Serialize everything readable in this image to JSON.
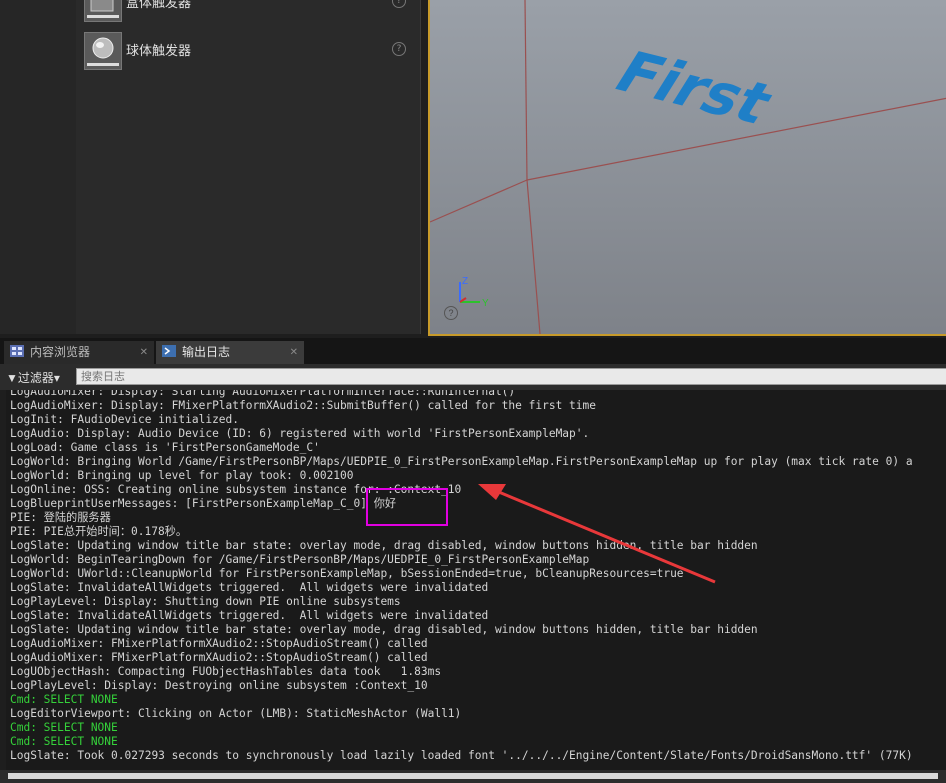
{
  "placement": {
    "items": [
      {
        "label": "盒体触发器"
      },
      {
        "label": "球体触发器"
      }
    ],
    "help_glyph": "?"
  },
  "viewport": {
    "floor_text": "First",
    "axes": {
      "z": "Z",
      "y": "Y"
    },
    "help_glyph": "?"
  },
  "tabs": [
    {
      "label": "内容浏览器",
      "active": false
    },
    {
      "label": "输出日志",
      "active": true
    }
  ],
  "tab_close_glyph": "✕",
  "filter": {
    "label": "▼过滤器▾",
    "search_placeholder": "搜索日志"
  },
  "log": [
    {
      "text": "LogAudioMixer: Display: Starting AudioMixerPlatformInterface::RunInternal()",
      "type": "normal"
    },
    {
      "text": "LogAudioMixer: Display: FMixerPlatformXAudio2::SubmitBuffer() called for the first time",
      "type": "normal"
    },
    {
      "text": "LogInit: FAudioDevice initialized.",
      "type": "normal"
    },
    {
      "text": "LogAudio: Display: Audio Device (ID: 6) registered with world 'FirstPersonExampleMap'.",
      "type": "normal"
    },
    {
      "text": "LogLoad: Game class is 'FirstPersonGameMode_C'",
      "type": "normal"
    },
    {
      "text": "LogWorld: Bringing World /Game/FirstPersonBP/Maps/UEDPIE_0_FirstPersonExampleMap.FirstPersonExampleMap up for play (max tick rate 0) a",
      "type": "normal"
    },
    {
      "text": "LogWorld: Bringing up level for play took: 0.002100",
      "type": "normal"
    },
    {
      "text": "LogOnline: OSS: Creating online subsystem instance for: :Context_10",
      "type": "normal"
    },
    {
      "text": "LogBlueprintUserMessages: [FirstPersonExampleMap_C_0] 你好",
      "type": "normal"
    },
    {
      "text": "PIE: 登陆的服务器",
      "type": "normal"
    },
    {
      "text": "PIE: PIE总开始时间：0.178秒。",
      "type": "normal"
    },
    {
      "text": "LogSlate: Updating window title bar state: overlay mode, drag disabled, window buttons hidden, title bar hidden",
      "type": "normal"
    },
    {
      "text": "LogWorld: BeginTearingDown for /Game/FirstPersonBP/Maps/UEDPIE_0_FirstPersonExampleMap",
      "type": "normal"
    },
    {
      "text": "LogWorld: UWorld::CleanupWorld for FirstPersonExampleMap, bSessionEnded=true, bCleanupResources=true",
      "type": "normal"
    },
    {
      "text": "LogSlate: InvalidateAllWidgets triggered.  All widgets were invalidated",
      "type": "normal"
    },
    {
      "text": "LogPlayLevel: Display: Shutting down PIE online subsystems",
      "type": "normal"
    },
    {
      "text": "LogSlate: InvalidateAllWidgets triggered.  All widgets were invalidated",
      "type": "normal"
    },
    {
      "text": "LogSlate: Updating window title bar state: overlay mode, drag disabled, window buttons hidden, title bar hidden",
      "type": "normal"
    },
    {
      "text": "LogAudioMixer: FMixerPlatformXAudio2::StopAudioStream() called",
      "type": "normal"
    },
    {
      "text": "LogAudioMixer: FMixerPlatformXAudio2::StopAudioStream() called",
      "type": "normal"
    },
    {
      "text": "LogUObjectHash: Compacting FUObjectHashTables data took   1.83ms",
      "type": "normal"
    },
    {
      "text": "LogPlayLevel: Display: Destroying online subsystem :Context_10",
      "type": "normal"
    },
    {
      "text": "Cmd: SELECT NONE",
      "type": "cmd"
    },
    {
      "text": "LogEditorViewport: Clicking on Actor (LMB): StaticMeshActor (Wall1)",
      "type": "normal"
    },
    {
      "text": "Cmd: SELECT NONE",
      "type": "cmd"
    },
    {
      "text": "Cmd: SELECT NONE",
      "type": "cmd"
    },
    {
      "text": "LogSlate: Took 0.027293 seconds to synchronously load lazily loaded font '../../../Engine/Content/Slate/Fonts/DroidSansMono.ttf' (77K)",
      "type": "normal"
    }
  ],
  "colors": {
    "accent": "#c79a2a",
    "annotation": "#e000e0",
    "arrow": "#e8383a",
    "cmd": "#35d13a"
  }
}
